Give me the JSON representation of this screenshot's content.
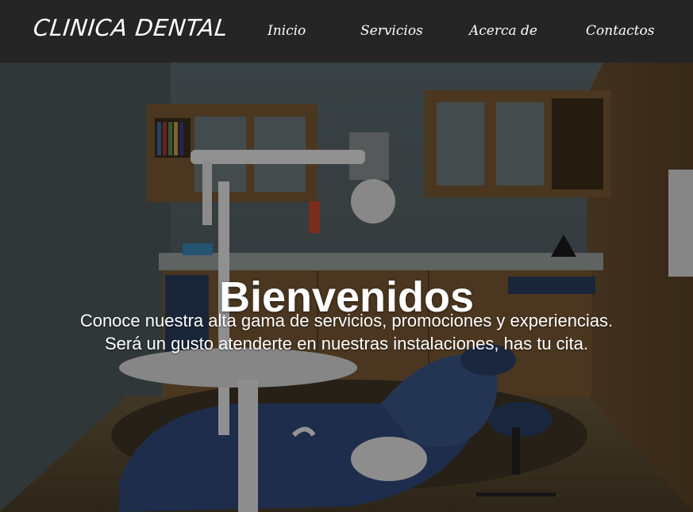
{
  "navbar": {
    "brand": "CLINICA DENTAL",
    "links": [
      {
        "label": "Inicio"
      },
      {
        "label": "Servicios"
      },
      {
        "label": "Acerca de"
      },
      {
        "label": "Contactos"
      }
    ]
  },
  "hero": {
    "title": "Bienvenidos",
    "line1": "Conoce nuestra alta gama de servicios, promociones y experiencias.",
    "line2": "Será un gusto atenderte en nuestras instalaciones, has tu cita.",
    "background_image": "dental-office-photo"
  },
  "colors": {
    "navbar_bg": "#252525",
    "text": "#ffffff",
    "chair": "#2f4a7a"
  }
}
